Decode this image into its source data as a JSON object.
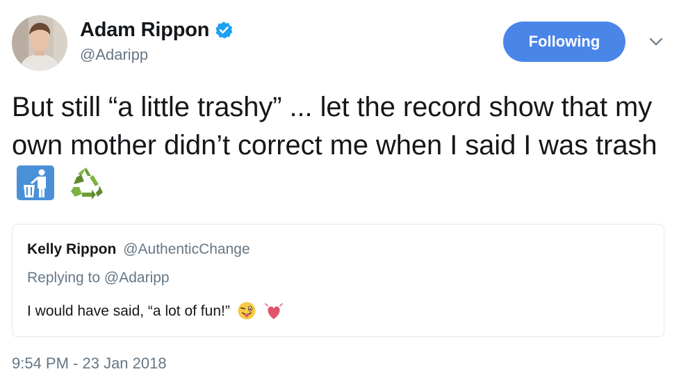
{
  "author": {
    "display_name": "Adam Rippon",
    "handle": "@Adaripp",
    "verified": true
  },
  "follow_button_label": "Following",
  "tweet": {
    "text": "But still “a little trashy” ... let the record show that my own mother didn’t correct me when I said I was trash",
    "emojis": [
      "put-litter-in-its-place-icon",
      "recycling-symbol-icon"
    ]
  },
  "quoted_tweet": {
    "display_name": "Kelly Rippon",
    "handle": "@AuthenticChange",
    "reply_prefix": "Replying to",
    "reply_to": "@Adaripp",
    "text": "I would have said, “a lot of fun!”",
    "emojis": [
      "winking-face-with-tongue-icon",
      "beating-heart-icon"
    ]
  },
  "timestamp": "9:54 PM - 23 Jan 2018",
  "colors": {
    "accent": "#4a86e8",
    "text": "#14171a",
    "secondary_text": "#657786",
    "border": "#e1e8ed",
    "verified_badge": "#1da1f2"
  }
}
